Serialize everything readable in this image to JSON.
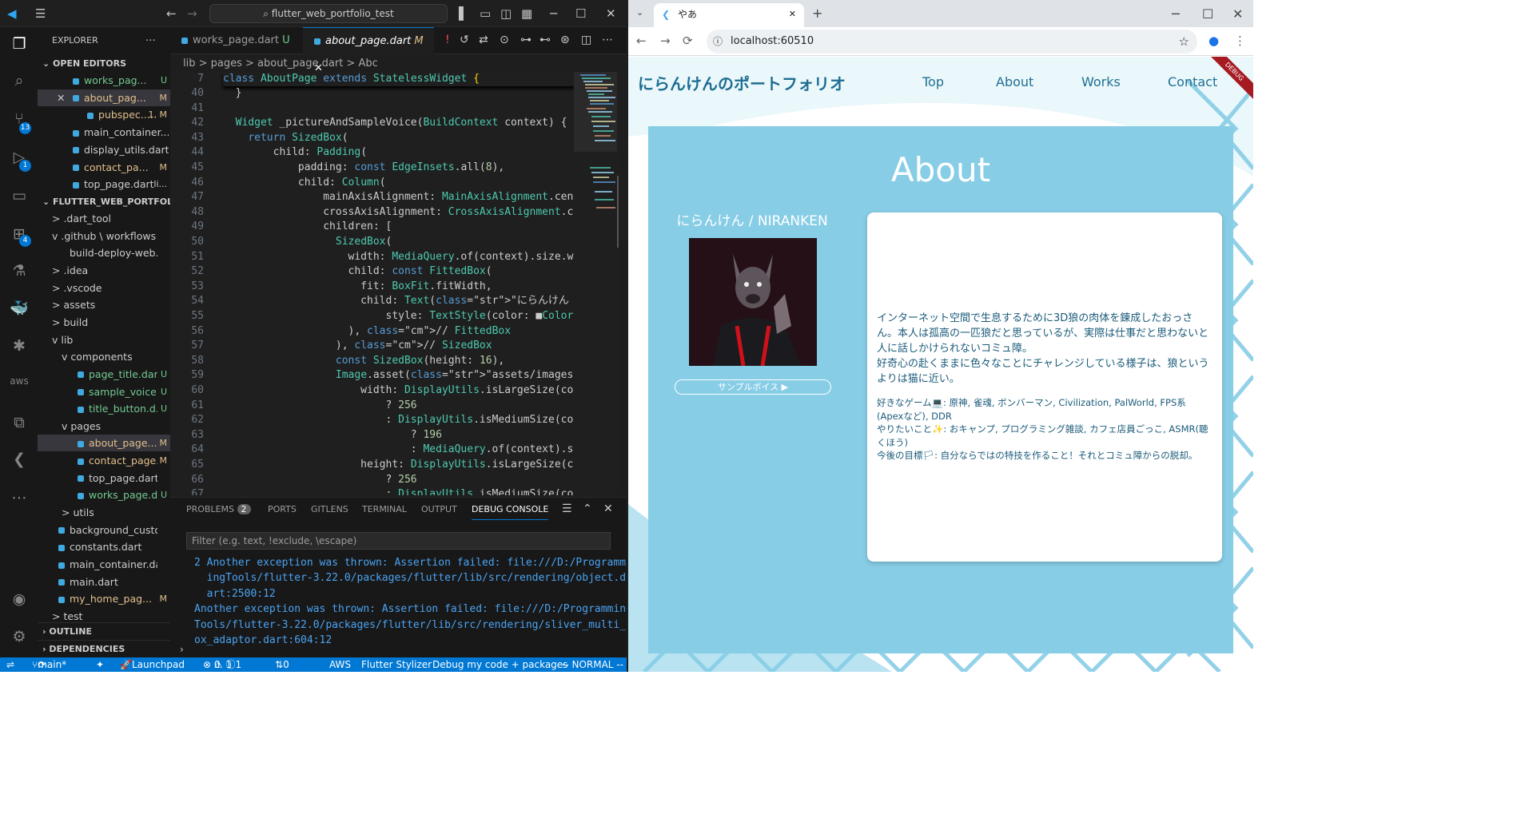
{
  "vscode": {
    "title_search": "flutter_web_portfolio_test",
    "activity_badges": {
      "source_control": "13",
      "run_debug": "1",
      "extensions": "4"
    },
    "explorer": {
      "header": "EXPLORER",
      "open_editors_label": "OPEN EDITORS",
      "open_editors": [
        {
          "name": "works_pag...",
          "status": "U"
        },
        {
          "name": "about_pag...",
          "status": "M"
        },
        {
          "name": "pubspec....",
          "status": "1, M"
        },
        {
          "name": "main_container....",
          "status": ""
        },
        {
          "name": "display_utils.dart...",
          "status": ""
        },
        {
          "name": "contact_pa...",
          "status": "M"
        },
        {
          "name": "top_page.dart",
          "status": "li..."
        }
      ],
      "project_label": "FLUTTER_WEB_PORTFOLIO...",
      "tree": [
        {
          "name": "> .dart_tool",
          "status": ""
        },
        {
          "name": "v .github \\ workflows",
          "status": ""
        },
        {
          "name": "build-deploy-web.yml",
          "status": ""
        },
        {
          "name": "> .idea",
          "status": ""
        },
        {
          "name": "> .vscode",
          "status": ""
        },
        {
          "name": "> assets",
          "status": ""
        },
        {
          "name": "> build",
          "status": ""
        },
        {
          "name": "v lib",
          "status": ""
        },
        {
          "name": "v components",
          "status": ""
        },
        {
          "name": "page_title.dart",
          "status": "U"
        },
        {
          "name": "sample_voice...",
          "status": "U"
        },
        {
          "name": "title_button.d...",
          "status": "U"
        },
        {
          "name": "v pages",
          "status": ""
        },
        {
          "name": "about_page....",
          "status": "M"
        },
        {
          "name": "contact_page...",
          "status": "M"
        },
        {
          "name": "top_page.dart",
          "status": ""
        },
        {
          "name": "works_page.d...",
          "status": "U"
        },
        {
          "name": "> utils",
          "status": ""
        },
        {
          "name": "background_custom...",
          "status": ""
        },
        {
          "name": "constants.dart",
          "status": ""
        },
        {
          "name": "main_container.dart",
          "status": ""
        },
        {
          "name": "main.dart",
          "status": ""
        },
        {
          "name": "my_home_pag...",
          "status": "M"
        },
        {
          "name": "> test",
          "status": ""
        }
      ],
      "outline_label": "OUTLINE",
      "dependencies_label": "DEPENDENCIES"
    },
    "tabs": [
      {
        "name": "works_page.dart",
        "status": "U"
      },
      {
        "name": "about_page.dart",
        "status": "M"
      }
    ],
    "breadcrumb": "lib > pages > about_page.dart > Abc",
    "sticky_line": {
      "num": "7",
      "text": "class AboutPage extends StatelessWidget {"
    },
    "code_lines": [
      {
        "num": "40",
        "text": "  }"
      },
      {
        "num": "41",
        "text": ""
      },
      {
        "num": "42",
        "text": "  Widget _pictureAndSampleVoice(BuildContext context) {"
      },
      {
        "num": "43",
        "text": "    return SizedBox("
      },
      {
        "num": "44",
        "text": "        child: Padding("
      },
      {
        "num": "45",
        "text": "            padding: const EdgeInsets.all(8),"
      },
      {
        "num": "46",
        "text": "            child: Column("
      },
      {
        "num": "47",
        "text": "                mainAxisAlignment: MainAxisAlignment.cente"
      },
      {
        "num": "48",
        "text": "                crossAxisAlignment: CrossAxisAlignment.cen"
      },
      {
        "num": "49",
        "text": "                children: ["
      },
      {
        "num": "50",
        "text": "                  SizedBox("
      },
      {
        "num": "51",
        "text": "                    width: MediaQuery.of(context).size.wid"
      },
      {
        "num": "52",
        "text": "                    child: const FittedBox("
      },
      {
        "num": "53",
        "text": "                      fit: BoxFit.fitWidth,"
      },
      {
        "num": "54",
        "text": "                      child: Text(\"にらんけん / NIRANKEN\","
      },
      {
        "num": "55",
        "text": "                          style: TextStyle(color: ■Colors"
      },
      {
        "num": "56",
        "text": "                    ), // FittedBox"
      },
      {
        "num": "57",
        "text": "                  ), // SizedBox"
      },
      {
        "num": "58",
        "text": "                  const SizedBox(height: 16),"
      },
      {
        "num": "59",
        "text": "                  Image.asset(\"assets/images/profile.png\","
      },
      {
        "num": "60",
        "text": "                      width: DisplayUtils.isLargeSize(cont"
      },
      {
        "num": "61",
        "text": "                          ? 256"
      },
      {
        "num": "62",
        "text": "                          : DisplayUtils.isMediumSize(cont"
      },
      {
        "num": "63",
        "text": "                              ? 196"
      },
      {
        "num": "64",
        "text": "                              : MediaQuery.of(context).siz"
      },
      {
        "num": "65",
        "text": "                      height: DisplayUtils.isLargeSize(cor"
      },
      {
        "num": "66",
        "text": "                          ? 256"
      },
      {
        "num": "67",
        "text": "                          : DisplayUtils.isMediumSize(cont"
      }
    ],
    "panel": {
      "tabs": [
        "PROBLEMS",
        "PORTS",
        "GITLENS",
        "TERMINAL",
        "OUTPUT",
        "DEBUG CONSOLE"
      ],
      "problems_count": "2",
      "filter_placeholder": "Filter (e.g. text, !exclude, \\escape)",
      "console_lines": [
        "2 Another exception was thrown: Assertion failed: file:///D:/Programm",
        "  ingTools/flutter-3.22.0/packages/flutter/lib/src/rendering/object.d",
        "  art:2500:12",
        "Another exception was thrown: Assertion failed: file:///D:/Programming",
        "Tools/flutter-3.22.0/packages/flutter/lib/src/rendering/sliver_multi_b",
        "ox_adaptor.dart:604:12"
      ]
    },
    "statusbar": {
      "branch": "main*",
      "launchpad": "Launchpad",
      "errors": "0",
      "warnings": "1",
      "info": "1",
      "ports": "0",
      "aws": "AWS",
      "stylizer": "Flutter Stylizer",
      "debug": "Debug my code + packages",
      "mode": "-- NORMAL --"
    }
  },
  "chrome": {
    "tab_title": "やあ",
    "url": "localhost:60510",
    "site": {
      "logo": "にらんけんのポートフォリオ",
      "nav": [
        "Top",
        "About",
        "Works",
        "Contact"
      ],
      "debug_banner": "DEBUG",
      "about_title": "About",
      "profile_name": "にらんけん / NIRANKEN",
      "voice_button": "サンプルボイス ▶",
      "bio": "インターネット空間で生息するために3D狼の肉体を錬成したおっさん。本人は孤高の一匹狼だと思っているが、実際は仕事だと思わないと人に話しかけられないコミュ障。\n好奇心の赴くままに色々なことにチャレンジしている様子は、狼というよりは猫に近い。",
      "prefs": [
        "好きなゲーム💻: 原神, 雀魂, ボンバーマン, Civilization, PalWorld, FPS系(Apexなど), DDR",
        "やりたいこと✨: おキャンプ, プログラミング雑談, カフェ店員ごっこ, ASMR(聴くほう)",
        "今後の目標🏳: 自分ならではの特技を作ること！それとコミュ障からの脱却。"
      ]
    }
  },
  "colors": {
    "vscode_accent": "#0078d4",
    "site_panel": "#87cde6",
    "site_text": "#1f6e93"
  }
}
